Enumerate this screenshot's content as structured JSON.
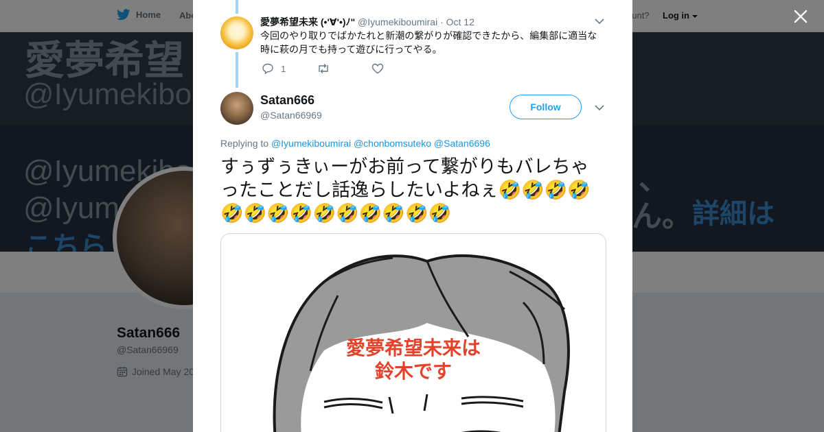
{
  "topbar": {
    "home_label": "Home",
    "about_label": "Abo",
    "account_prompt": "ccount?",
    "login_label": "Log in"
  },
  "banner": {
    "line1": "愛夢希望",
    "line2": "@Iyumekibo",
    "line3": "@Iyumekibou",
    "line4": "@Iyume",
    "line5": "こちら",
    "right1": "、",
    "right2": "ん。",
    "right3": "詳細は"
  },
  "profile": {
    "name": "Satan666",
    "handle": "@Satan66969",
    "joined": "Joined May 20"
  },
  "previous_tweet": {
    "name": "愛夢希望未来 (•'∀'•)ﾉ\"",
    "handle": "@Iyumekiboumirai",
    "date": "· Oct 12",
    "text": "今回のやり取りでばかたれと新潮の繋がりが確認できたから、編集部に適当な時に萩の月でも持って遊びに行ってやる。",
    "reply_count": "1"
  },
  "tweet": {
    "name": "Satan666",
    "handle": "@Satan66969",
    "follow_label": "Follow",
    "replying_prefix": "Replying to",
    "mentions": [
      "@Iyumekiboumirai",
      "@chonbomsuteko",
      "@Satan6696"
    ],
    "text": "すぅずぅきぃーがお前って繋がりもバレちゃったことだし話逸らしたいよねぇ🤣🤣🤣🤣🤣🤣🤣🤣🤣🤣🤣🤣🤣🤣",
    "media_caption_line1": "愛夢希望未来は",
    "media_caption_line2": "鈴木です"
  },
  "colors": {
    "accent": "#1da1f2",
    "mention": "#1b95e0",
    "thread_line": "#a3d3f5",
    "caption_red": "#e4432b"
  },
  "icons": [
    "twitter-bird-icon",
    "caret-down-icon",
    "close-icon",
    "reply-icon",
    "retweet-icon",
    "like-icon",
    "calendar-icon"
  ]
}
